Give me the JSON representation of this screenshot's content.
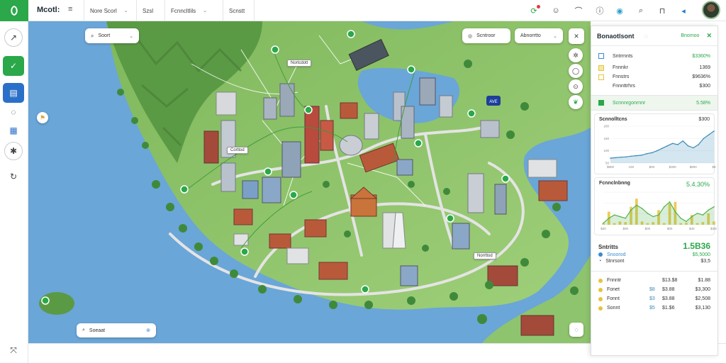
{
  "header": {
    "brand": "Mcotl:",
    "menu_label": "≡",
    "dropdowns": [
      {
        "label": "Nore Scorl"
      },
      {
        "label": "Szsl"
      },
      {
        "label": "Fcnncltlils"
      },
      {
        "label": "Scnstt"
      }
    ]
  },
  "map": {
    "search_primary": "Soort",
    "search_secondary": "Scntroor",
    "search_tertiary": "Abnorrtto",
    "place_tags": [
      "Nortcdott",
      "Corttod",
      "Norrttod"
    ],
    "bottom_search": "Soeaat",
    "transit_label": "AVE",
    "colors": {
      "water": "#6aa6d8",
      "land": "#8fc46e",
      "forest": "#5b9a45",
      "road": "#d8d8d8",
      "accent": "#2aa84a"
    }
  },
  "panel": {
    "title": "Bonaotlsont",
    "title_link": "Bnomoo",
    "rows_top": [
      {
        "label": "Sntrrnnts",
        "value": "$3360%"
      },
      {
        "label": "Fnnnkr",
        "value": "1369"
      },
      {
        "label": "Fnnstrs",
        "value": "$9636%"
      },
      {
        "label": "Fnnnttrhrs",
        "value": "$300"
      }
    ],
    "highlight": {
      "label": "Scnnnrgonrnnr",
      "value": "5.58%"
    },
    "rows_bottom": [
      {
        "label": "Fnnntr",
        "dot": "#e8c33a",
        "mid": "",
        "value": "$13.$8",
        "value2": "$1.88"
      },
      {
        "label": "Fonet",
        "dot": "#e8c33a",
        "mid": "$8",
        "value": "$3.88",
        "value2": "$3,300"
      },
      {
        "label": "Fonnt",
        "dot": "#e8c33a",
        "mid": "$3",
        "value": "$3.88",
        "value2": "$2,508"
      },
      {
        "label": "Sonnt",
        "dot": "#e8c33a",
        "mid": "$5",
        "value": "$1.$6",
        "value2": "$3,130"
      }
    ],
    "summary": {
      "label": "Sntritts",
      "value": "1.5B36",
      "sub1": "Snoorod",
      "sub1_val": "$5,5000",
      "sub2": "Stnrsont",
      "sub2_val": "$3,5"
    }
  },
  "chart_data": [
    {
      "type": "area",
      "title": "Scnnolltcns",
      "title_value": "$300",
      "y_ticks": [
        "200",
        "150",
        "100",
        "50"
      ],
      "x_ticks": [
        "$800",
        "100",
        "$00",
        "$300",
        "$800",
        "$8"
      ],
      "x": [
        0,
        1,
        2,
        3,
        4,
        5,
        6,
        7,
        8,
        9,
        10,
        11,
        12,
        13,
        14,
        15,
        16,
        17,
        18,
        19,
        20
      ],
      "values": [
        20,
        22,
        24,
        25,
        28,
        30,
        32,
        38,
        42,
        50,
        60,
        70,
        80,
        75,
        90,
        70,
        62,
        75,
        100,
        115,
        130
      ],
      "ylim": [
        0,
        150
      ],
      "color": "#3a8bb6"
    },
    {
      "type": "area",
      "title": "Fcnnclnbnng",
      "title_value": "5.4.30%",
      "x_ticks": [
        "$20",
        "$00",
        "$00",
        "$00",
        "$40",
        "$300"
      ],
      "x": [
        0,
        1,
        2,
        3,
        4,
        5,
        6,
        7,
        8,
        9,
        10,
        11,
        12,
        13,
        14,
        15,
        16,
        17,
        18,
        19,
        20
      ],
      "values": [
        5,
        20,
        30,
        25,
        20,
        45,
        60,
        50,
        35,
        25,
        30,
        55,
        70,
        40,
        20,
        10,
        25,
        35,
        30,
        45,
        55
      ],
      "bars": [
        5,
        40,
        5,
        10,
        8,
        55,
        80,
        10,
        5,
        8,
        45,
        5,
        65,
        70,
        5,
        6,
        30,
        5,
        8,
        35,
        10
      ],
      "ylim": [
        0,
        100
      ],
      "color": "#53b24f",
      "bar_color": "#e8c33a"
    }
  ]
}
